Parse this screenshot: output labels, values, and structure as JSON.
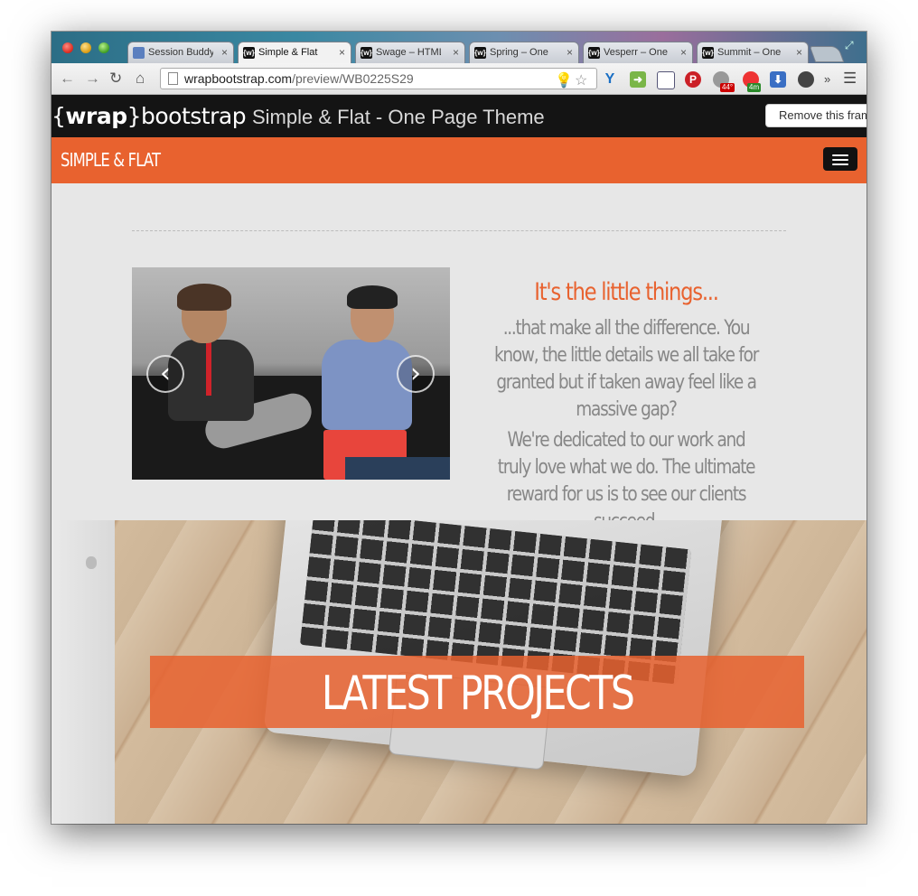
{
  "browser": {
    "tabs": [
      {
        "title": "Session Buddy",
        "favicon": "session-buddy-icon",
        "active": false
      },
      {
        "title": "Simple & Flat",
        "favicon": "wrapbootstrap-icon",
        "active": true
      },
      {
        "title": "Swage – HTML",
        "favicon": "wrapbootstrap-icon",
        "active": false
      },
      {
        "title": "Spring – One",
        "favicon": "wrapbootstrap-icon",
        "active": false
      },
      {
        "title": "Vesperr – One",
        "favicon": "wrapbootstrap-icon",
        "active": false
      },
      {
        "title": "Summit – One",
        "favicon": "wrapbootstrap-icon",
        "active": false
      }
    ],
    "favicon_letter": "{w}",
    "tab_close": "×",
    "url_host": "wrapbootstrap.com",
    "url_path": "/preview/WB0225S29",
    "extension_badges": {
      "weather": "44°",
      "timer": "4m"
    },
    "overflow_label": "»"
  },
  "wrapbar": {
    "logo_left": "{",
    "logo_bold": "wrap",
    "logo_right": "}bootstrap",
    "page_title": "Simple & Flat - One Page Theme",
    "remove_frame_label": "Remove this frame"
  },
  "site": {
    "brand": "SIMPLE & FLAT",
    "intro_heading": "It's the little things...",
    "intro_paragraph_1": "...that make all the difference. You know, the little details we all take for granted but if taken away feel like a massive gap?",
    "intro_paragraph_2": "We're dedicated to our work and truly love what we do. The ultimate reward for us is to see our clients succeed.",
    "carousel_prev": "‹",
    "carousel_next": "›",
    "hero_banner": "LATEST PROJECTS"
  },
  "colors": {
    "accent": "#e8622f",
    "dark_bar": "#141414",
    "body_text": "#878787"
  }
}
